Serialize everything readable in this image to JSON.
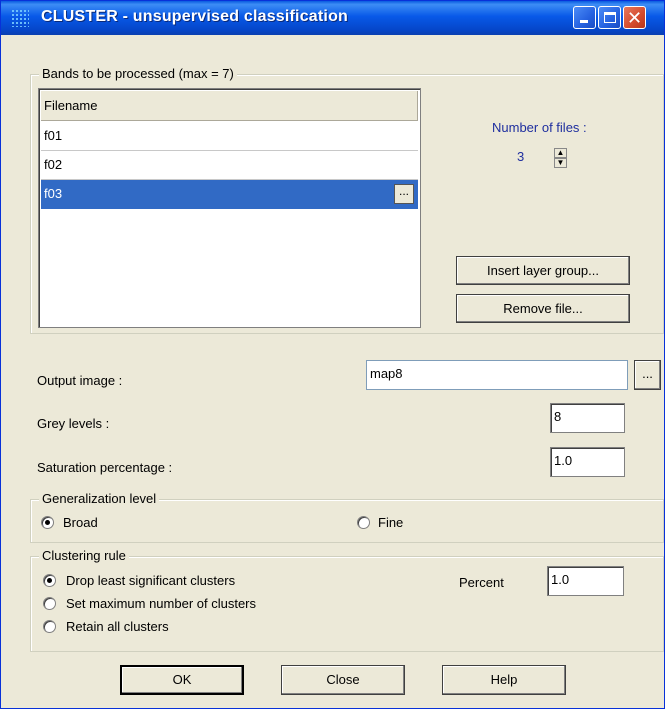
{
  "window": {
    "title": "CLUSTER - unsupervised classification"
  },
  "bands": {
    "group_label": "Bands to be processed (max = 7)",
    "column_header": "Filename",
    "rows": [
      "f01",
      "f02",
      "f03"
    ],
    "selected_row_button": "...",
    "num_files_label": "Number of files :",
    "num_files_value": "3",
    "insert_button": "Insert layer group...",
    "remove_button": "Remove file..."
  },
  "output": {
    "output_image_label": "Output image :",
    "output_image_value": "map8",
    "browse_button": "...",
    "grey_levels_label": "Grey levels :",
    "grey_levels_value": "8",
    "saturation_label": "Saturation percentage  :",
    "saturation_value": "1.0"
  },
  "generalization": {
    "group_label": "Generalization level",
    "options": [
      "Broad",
      "Fine"
    ],
    "selected": "Broad"
  },
  "clustering": {
    "group_label": "Clustering rule",
    "options": [
      "Drop least significant clusters",
      "Set maximum number of clusters",
      "Retain all clusters"
    ],
    "selected": "Drop least significant clusters",
    "percent_label": "Percent",
    "percent_value": "1.0"
  },
  "footer": {
    "ok_label": "OK",
    "close_label": "Close",
    "help_label": "Help"
  },
  "colors": {
    "titlebar": "#0859e8",
    "selection": "#316ac5",
    "dialog_bg": "#ece9d8"
  }
}
